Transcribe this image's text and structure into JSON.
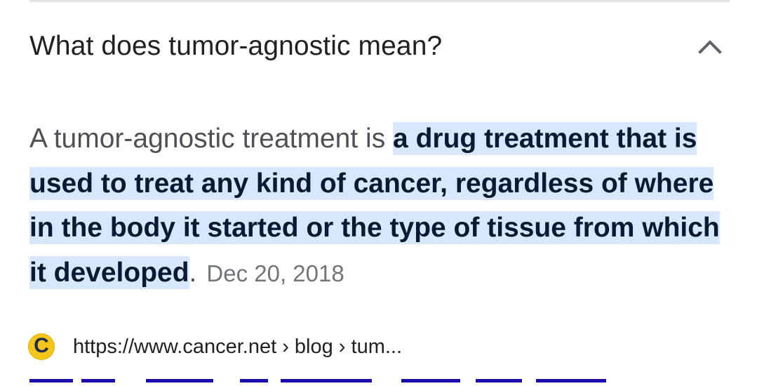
{
  "faq": {
    "question": "What does tumor-agnostic mean?",
    "toggle_icon": "chevron-up-icon"
  },
  "answer": {
    "intro": "A tumor-agnostic treatment is ",
    "highlight": "a drug treatment that is used to treat any kind of cancer, regardless of where in the body it started or the type of tissue from which it developed",
    "trailing": ".",
    "date": "Dec 20, 2018"
  },
  "source": {
    "favicon_letter": "C",
    "favicon_color": "#f5c518",
    "url": "https://www.cancer.net › blog › tum..."
  },
  "colors": {
    "highlight_bg": "#d8e7fb",
    "link": "#1a0dab"
  }
}
